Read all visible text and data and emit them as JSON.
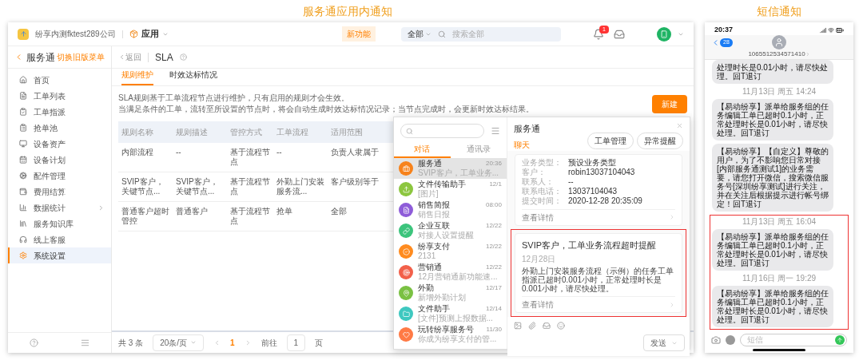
{
  "headings": [
    "服务通应用内通知",
    "短信通知"
  ],
  "app": {
    "company": "纷享内测fktest289公司",
    "app_menu": "应用",
    "new_feature_badge": "新功能",
    "search": {
      "scope": "全部",
      "placeholder": "搜索全部"
    },
    "notification_count": "1",
    "sidebar": {
      "title": "服务通",
      "switch_link": "切换旧版菜单",
      "items": [
        {
          "label": "首页",
          "selected": false,
          "expandable": false
        },
        {
          "label": "工单列表",
          "selected": false,
          "expandable": false
        },
        {
          "label": "工单指派",
          "selected": false,
          "expandable": false
        },
        {
          "label": "抢单池",
          "selected": false,
          "expandable": false
        },
        {
          "label": "设备资产",
          "selected": false,
          "expandable": false
        },
        {
          "label": "设备计划",
          "selected": false,
          "expandable": false
        },
        {
          "label": "配件管理",
          "selected": false,
          "expandable": false
        },
        {
          "label": "费用结算",
          "selected": false,
          "expandable": false
        },
        {
          "label": "数据统计",
          "selected": false,
          "expandable": true
        },
        {
          "label": "服务知识库",
          "selected": false,
          "expandable": false
        },
        {
          "label": "线上客服",
          "selected": false,
          "expandable": false
        },
        {
          "label": "系统设置",
          "selected": true,
          "expandable": false
        }
      ]
    },
    "breadcrumb": {
      "back": "返回",
      "title": "SLA"
    },
    "tabs": [
      {
        "label": "规则维护",
        "selected": true
      },
      {
        "label": "时效达标情况",
        "selected": false
      }
    ],
    "description": [
      "SLA规则基于工单流程节点进行维护，只有启用的规则才会生效。",
      "当满足条件的工单，流转至所设置的节点时，将会自动生成时效达标情况记录；当节点完成时，会更新时效达标结果。"
    ],
    "new_button": "新建",
    "table": {
      "columns": [
        "规则名称",
        "规则描述",
        "管控方式",
        "工单流程",
        "适用范围"
      ],
      "rows": [
        [
          "内部流程",
          "--",
          "基于流程节点",
          "--",
          "负责人隶属于"
        ],
        [
          "SVIP客户，关键节点...",
          "SVIP客户，关键节点...",
          "基于流程节点",
          "外勤上门安装服务流...",
          "客户级别等于"
        ],
        [
          "普通客户超时管控",
          "普通客户",
          "基于流程节点",
          "抢单",
          "全部"
        ]
      ]
    },
    "pagination": {
      "total": "共 3 条",
      "page_size": "20条/页",
      "pages": [
        {
          "label": "1",
          "selected": true
        }
      ],
      "goto_label": "前往",
      "goto_value": "1",
      "goto_suffix": "页"
    },
    "chat": {
      "tabs": [
        {
          "label": "对话",
          "selected": true
        },
        {
          "label": "通讯录",
          "selected": false
        }
      ],
      "conversations": [
        {
          "name": "服务通",
          "time": "20:36",
          "preview": "SVIP客户，工单业务...",
          "color": "#f7821b",
          "selected": true
        },
        {
          "name": "文件传输助手",
          "time": "12/1",
          "preview": "[图片]",
          "color": "#8cc63f",
          "selected": false
        },
        {
          "name": "销售简报",
          "time": "08:00",
          "preview": "销售日报",
          "color": "#8e5cd9",
          "selected": false
        },
        {
          "name": "企业互联",
          "time": "12/22",
          "preview": "对接人设置提醒",
          "color": "#3cc47c",
          "selected": false
        },
        {
          "name": "纷享支付",
          "time": "12/22",
          "preview": "2131",
          "color": "#ff8b1f",
          "selected": false
        },
        {
          "name": "营销通",
          "time": "12/22",
          "preview": "12月营销通新功能速...",
          "color": "#f2604a",
          "selected": false
        },
        {
          "name": "外勤",
          "time": "12/17",
          "preview": "新增外勤计划",
          "color": "#7ac143",
          "selected": false
        },
        {
          "name": "文件助手",
          "time": "12/14",
          "preview": "[文件]预测上报数据...",
          "color": "#3ec8c0",
          "selected": false
        },
        {
          "name": "玩转纷享服务号",
          "time": "11/30",
          "preview": "你成为纷享支付的管...",
          "color": "#ff7a45",
          "selected": false
        }
      ],
      "title": "服务通",
      "subtab": "聊天",
      "actions": [
        "工单管理",
        "异常提醒"
      ],
      "messages": [
        {
          "kind": "record",
          "highlighted": false,
          "fields": [
            {
              "label": "业务类型：",
              "value": "预设业务类型"
            },
            {
              "label": "客户：",
              "value": "robin13037104043"
            },
            {
              "label": "联系人：",
              "value": "--"
            },
            {
              "label": "联系电话：",
              "value": "13037104043"
            },
            {
              "label": "提交时间：",
              "value": "2020-12-28 20:35:09"
            }
          ],
          "link": "查看详情"
        },
        {
          "kind": "alert",
          "highlighted": true,
          "title": "SVIP客户，工单业务流程超时提醒",
          "date": "12月28日",
          "body": "外勤上门安装服务流程（示例）的任务工单指派已超时0.001小时，正常处理时长是0.001小时，请尽快处理。",
          "link": "查看详情"
        }
      ],
      "send_button": "发送"
    }
  },
  "phone": {
    "time": "20:37",
    "back_badge": "28",
    "sender": "1065512534571410",
    "input_placeholder": "短信",
    "thread": [
      {
        "kind": "message",
        "highlighted": false,
        "text": "处理时长是0.01小时，请尽快处理。回T退订"
      },
      {
        "kind": "timestamp",
        "highlighted": false,
        "text": "11月13日 周五 14:24"
      },
      {
        "kind": "message",
        "highlighted": false,
        "text": "【易动纷享】派单给服务组的任务编辑工单已超时0.1小时，正常处理时长是0.01小时，请尽快处理。回T退订"
      },
      {
        "kind": "message",
        "highlighted": false,
        "text": "【易动纷享】【自定义】尊敬的用户，为了不影响您日常对接[内部服务通测试1]的业务需要，请您打开微信，搜索微信服务号[深圳纷享测试]进行关注，并在关注后根据提示进行帐号绑定！回T退订"
      },
      {
        "kind": "timestamp",
        "highlighted": true,
        "text": "11月13日 周五 16:04"
      },
      {
        "kind": "message",
        "highlighted": true,
        "text": "【易动纷享】派单给服务组的任务编辑工单已超时0.1小时，正常处理时长是0.01小时，请尽快处理。回T退订"
      },
      {
        "kind": "timestamp",
        "highlighted": true,
        "text": "11月16日 周一 19:29"
      },
      {
        "kind": "message",
        "highlighted": true,
        "text": "【易动纷享】派单给服务组的任务编辑工单已超时0.1小时，正常处理时长是0.01小时，请尽快处理。回T退订"
      }
    ]
  }
}
